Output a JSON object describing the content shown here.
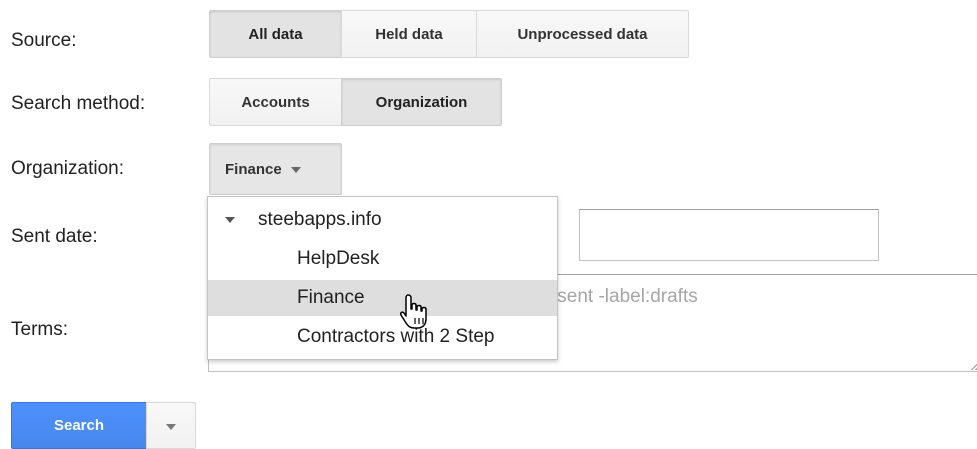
{
  "labels": {
    "source": "Source:",
    "search_method": "Search method:",
    "organization": "Organization:",
    "sent_date": "Sent date:",
    "terms": "Terms:"
  },
  "source_options": [
    "All data",
    "Held data",
    "Unprocessed data"
  ],
  "source_selected": "All data",
  "search_method_options": [
    "Accounts",
    "Organization"
  ],
  "search_method_selected": "Organization",
  "organization_dropdown": {
    "value": "Finance",
    "icon": "chevron-down-icon"
  },
  "org_tree": {
    "root": "steebapps.info",
    "children": [
      "HelpDesk",
      "Finance",
      "Contractors with 2 Step"
    ],
    "highlighted": "Finance"
  },
  "sent_date": {
    "value": ""
  },
  "terms": {
    "placeholder": ":sent -label:drafts"
  },
  "search": {
    "label": "Search",
    "more_icon": "chevron-down-icon"
  },
  "colors": {
    "primary_blue": "#4d90fe",
    "selected_segment": "#e3e3e3",
    "highlight_row": "#dedede"
  }
}
